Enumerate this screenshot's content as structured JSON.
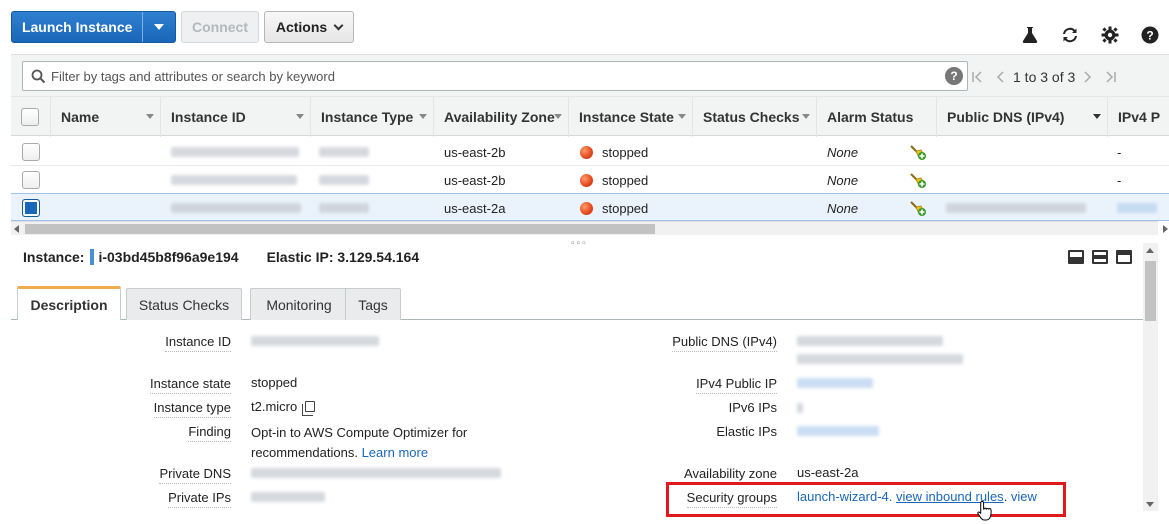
{
  "toolbar": {
    "launch_label": "Launch Instance",
    "connect_label": "Connect",
    "actions_label": "Actions"
  },
  "filter": {
    "placeholder": "Filter by tags and attributes or search by keyword",
    "help": "?",
    "pager_text": "1 to 3 of 3"
  },
  "table": {
    "columns": [
      "Name",
      "Instance ID",
      "Instance Type",
      "Availability Zone",
      "Instance State",
      "Status Checks",
      "Alarm Status",
      "Public DNS (IPv4)",
      "IPv4 P"
    ],
    "rows": [
      {
        "zone": "us-east-2b",
        "state": "stopped",
        "alarm": "None",
        "ipv4": "-",
        "selected": false
      },
      {
        "zone": "us-east-2b",
        "state": "stopped",
        "alarm": "None",
        "ipv4": "-",
        "selected": false
      },
      {
        "zone": "us-east-2a",
        "state": "stopped",
        "alarm": "None",
        "ipv4": "",
        "selected": true
      }
    ]
  },
  "detail": {
    "instance_label": "Instance:",
    "instance_id": "i-03bd45b8f96a9e194",
    "elastic_label": "Elastic IP: 3.129.54.164",
    "tabs": [
      "Description",
      "Status Checks",
      "Monitoring",
      "Tags"
    ],
    "left_fields": {
      "instance_id_label": "Instance ID",
      "instance_state_label": "Instance state",
      "instance_state": "stopped",
      "instance_type_label": "Instance type",
      "instance_type": "t2.micro",
      "finding_label": "Finding",
      "finding_text_1": "Opt-in to AWS Compute Optimizer for",
      "finding_text_2": "recommendations.",
      "finding_link": "Learn more",
      "private_dns_label": "Private DNS",
      "private_ips_label": "Private IPs"
    },
    "right_fields": {
      "public_dns_label": "Public DNS (IPv4)",
      "ipv4_public_label": "IPv4 Public IP",
      "ipv6_label": "IPv6 IPs",
      "elastic_ips_label": "Elastic IPs",
      "az_label": "Availability zone",
      "az_value": "us-east-2a",
      "sg_label": "Security groups",
      "sg_value": "launch-wizard-4.",
      "sg_link1": "view inbound rules",
      "sg_link2": "view",
      "sg_sep": ". "
    }
  },
  "colors": {
    "primary": "#1a66b8",
    "stopped": "#e2461b",
    "highlight": "#e0191b",
    "tab_accent": "#f0ad4e"
  }
}
